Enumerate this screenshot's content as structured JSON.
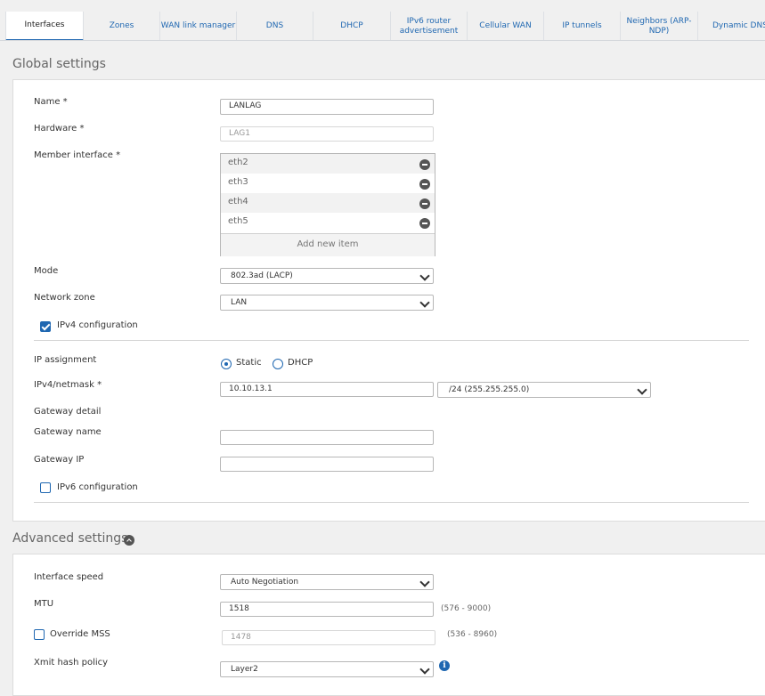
{
  "tabs": [
    {
      "label": "Interfaces"
    },
    {
      "label": "Zones"
    },
    {
      "label": "WAN link manager"
    },
    {
      "label": "DNS"
    },
    {
      "label": "DHCP"
    },
    {
      "label": "IPv6 router advertisement"
    },
    {
      "label": "Cellular WAN"
    },
    {
      "label": "IP tunnels"
    },
    {
      "label": "Neighbors (ARP-NDP)"
    },
    {
      "label": "Dynamic DNS"
    }
  ],
  "global": {
    "title": "Global settings",
    "name_label": "Name *",
    "name_value": "LANLAG",
    "hardware_label": "Hardware *",
    "hardware_value": "LAG1",
    "member_label": "Member interface *",
    "members": [
      "eth2",
      "eth3",
      "eth4",
      "eth5"
    ],
    "add_new_item": "Add new item",
    "mode_label": "Mode",
    "mode_value": "802.3ad (LACP)",
    "zone_label": "Network zone",
    "zone_value": "LAN",
    "ipv4_config_label": "IPv4 configuration",
    "ip_assignment_label": "IP assignment",
    "static_label": "Static",
    "dhcp_label": "DHCP",
    "ipv4_label": "IPv4/netmask *",
    "ipv4_value": "10.10.13.1",
    "netmask_value": "/24 (255.255.255.0)",
    "gateway_detail_label": "Gateway detail",
    "gateway_name_label": "Gateway name",
    "gateway_name_value": "",
    "gateway_ip_label": "Gateway IP",
    "gateway_ip_value": "",
    "ipv6_config_label": "IPv6 configuration"
  },
  "advanced": {
    "title": "Advanced settings",
    "speed_label": "Interface speed",
    "speed_value": "Auto Negotiation",
    "mtu_label": "MTU",
    "mtu_value": "1518",
    "mtu_range": "(576 - 9000)",
    "override_mss_label": "Override MSS",
    "mss_value": "1478",
    "mss_range": "(536 - 8960)",
    "xmit_label": "Xmit hash policy",
    "xmit_value": "Layer2"
  },
  "colors": {
    "accent": "#1f67b1",
    "background": "#f0f0f0",
    "panel": "#ffffff"
  }
}
